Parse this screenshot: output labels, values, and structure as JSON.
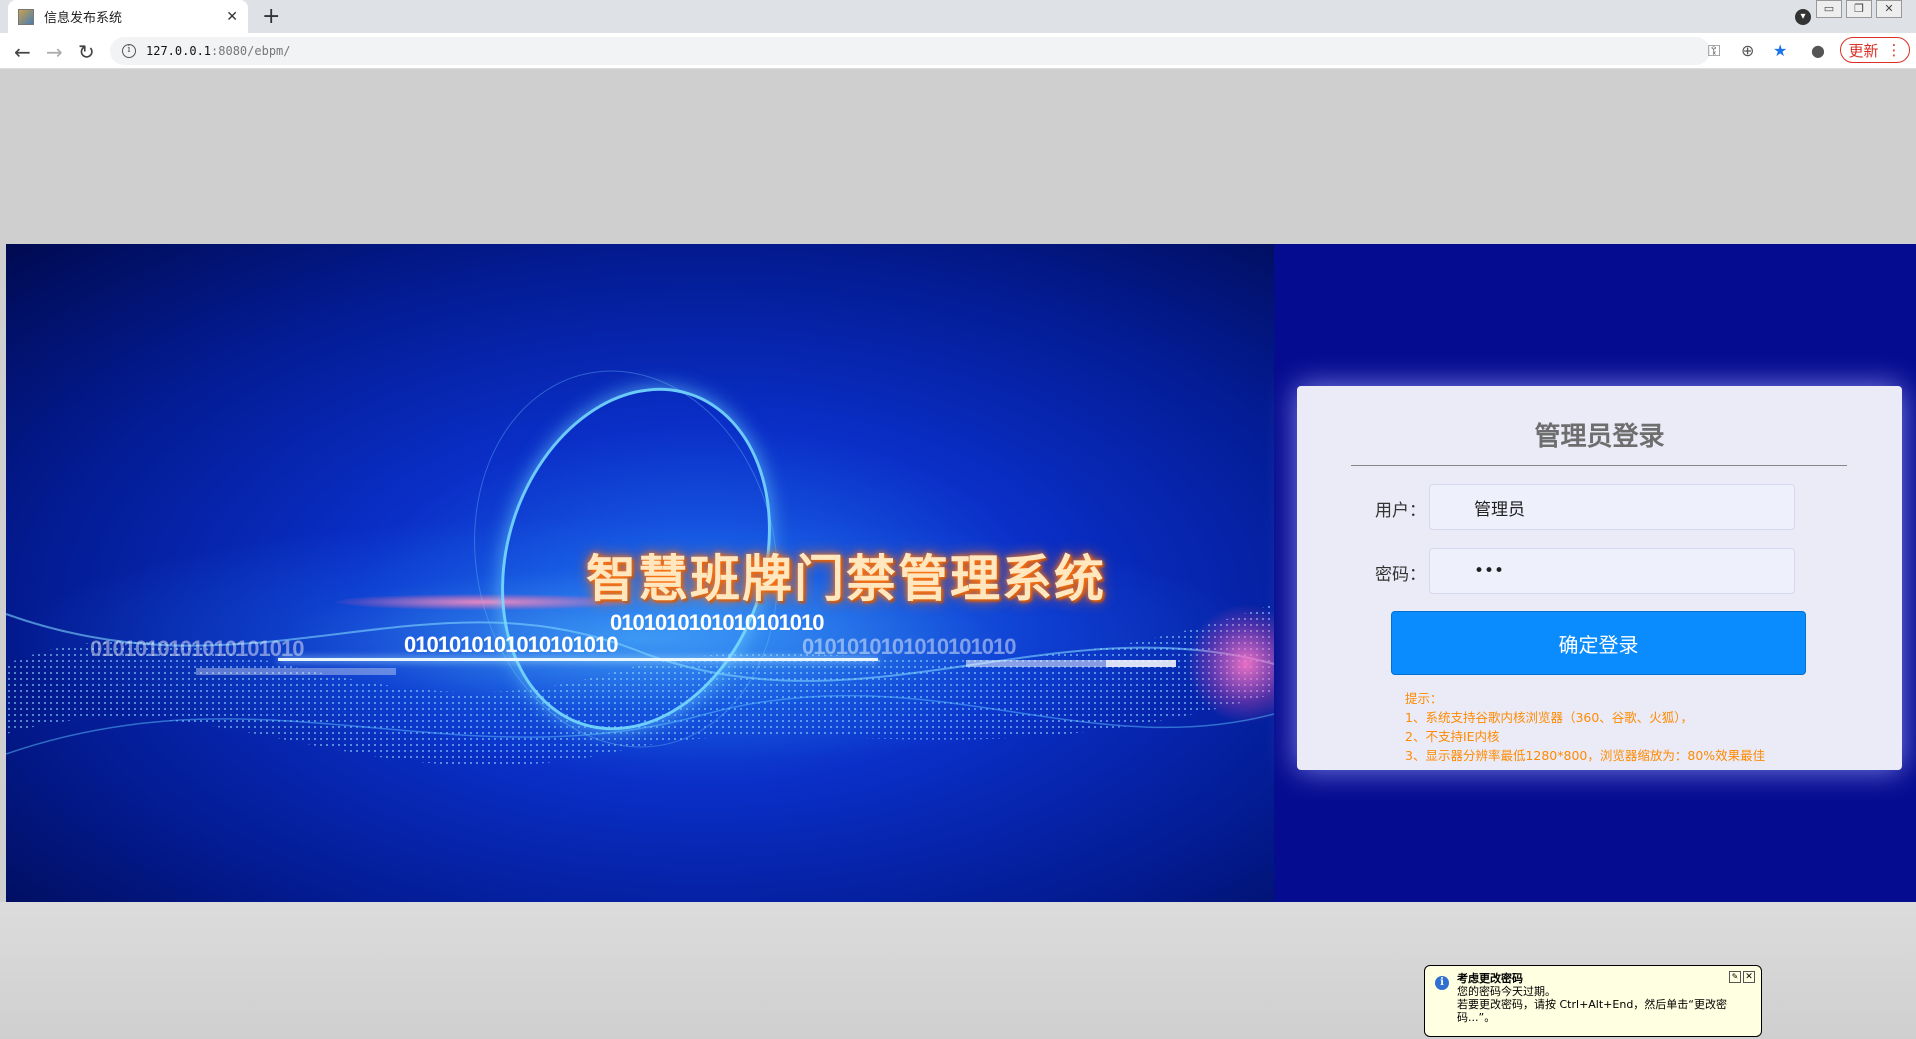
{
  "browser": {
    "tab_title": "信息发布系统",
    "tab_close": "✕",
    "new_tab": "+",
    "url_host": "127.0.0.1",
    "url_path": ":8080/ebpm/",
    "update_label": "更新",
    "menu_glyph": "⋮"
  },
  "banner": {
    "title": "智慧班牌门禁管理系统",
    "binary_main": "0101010101010101010",
    "binary_line": "0101010101010101010",
    "binary_left": "0101010101010101010",
    "binary_right": "0101010101010101010"
  },
  "login": {
    "title": "管理员登录",
    "user_label": "用户：",
    "user_value": "管理员",
    "password_label": "密码：",
    "password_value": "•••",
    "submit_label": "确定登录",
    "tips": [
      "提示：",
      "1、系统支持谷歌内核浏览器（360、谷歌、火狐），",
      "2、不支持IE内核",
      "3、显示器分辨率最低1280*800，浏览器缩放为：80%效果最佳"
    ]
  },
  "tray_balloon": {
    "title": "考虑更改密码",
    "line1": "您的密码今天过期。",
    "line2": "若要更改密码，请按 Ctrl+Alt+End，然后单击“更改密",
    "line3": "码...”。"
  }
}
